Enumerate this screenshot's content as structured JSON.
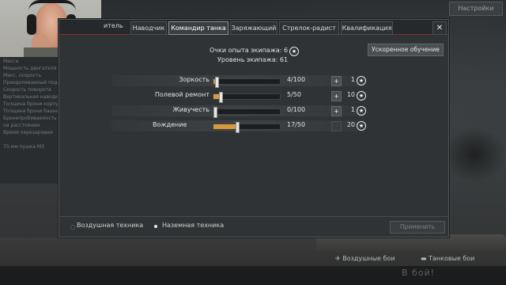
{
  "top_right": {
    "label": "Настройки"
  },
  "left_panel": {
    "lines": [
      "Масса",
      "Мощность двигателя",
      "Макс. скорость",
      "Преодолеваемый подъём",
      "Скорость поворота",
      "Вертикальная наводка",
      "Толщина брони корпуса",
      "Толщина брони башни",
      "Бронепробиваемость",
      "на расстоянии",
      "Время перезарядки",
      "",
      "75-мм пушка M3"
    ]
  },
  "tabs": {
    "partial_first": "итель",
    "items": [
      {
        "label": "Наводчик"
      },
      {
        "label": "Командир танка"
      },
      {
        "label": "Заряжающий"
      },
      {
        "label": "Стрелок-радист"
      },
      {
        "label": "Квалификация"
      }
    ],
    "close": "✕"
  },
  "crew": {
    "points_label": "Очки опыта экипажа: 6",
    "level_label": "Уровень экипажа: 61",
    "accelerate_button": "Ускоренное обучение"
  },
  "skills": [
    {
      "name": "Зоркость",
      "value": "4/100",
      "progress": 0.04,
      "plus": "+",
      "cost": "1"
    },
    {
      "name": "Полевой ремонт",
      "value": "5/50",
      "progress": 0.1,
      "plus": "+",
      "cost": "10"
    },
    {
      "name": "Живучесть",
      "value": "0/100",
      "progress": 0.0,
      "plus": "+",
      "cost": "1"
    },
    {
      "name": "Вождение",
      "value": "17/50",
      "progress": 0.34,
      "plus": "",
      "cost": "20"
    }
  ],
  "filters": {
    "air": "Воздушная техника",
    "ground": "Наземная техника",
    "apply": "Применить"
  },
  "bottom": {
    "air_battles": "Воздушные бои",
    "tank_battles": "Танковые бои",
    "to_battle": "В бой!"
  },
  "colors": {
    "accent_orange": "#d69a3a",
    "tab_underline_red": "#8b2a26"
  },
  "icons": {
    "star": "star-circle-icon",
    "close": "close-icon",
    "plus": "plus-icon"
  }
}
